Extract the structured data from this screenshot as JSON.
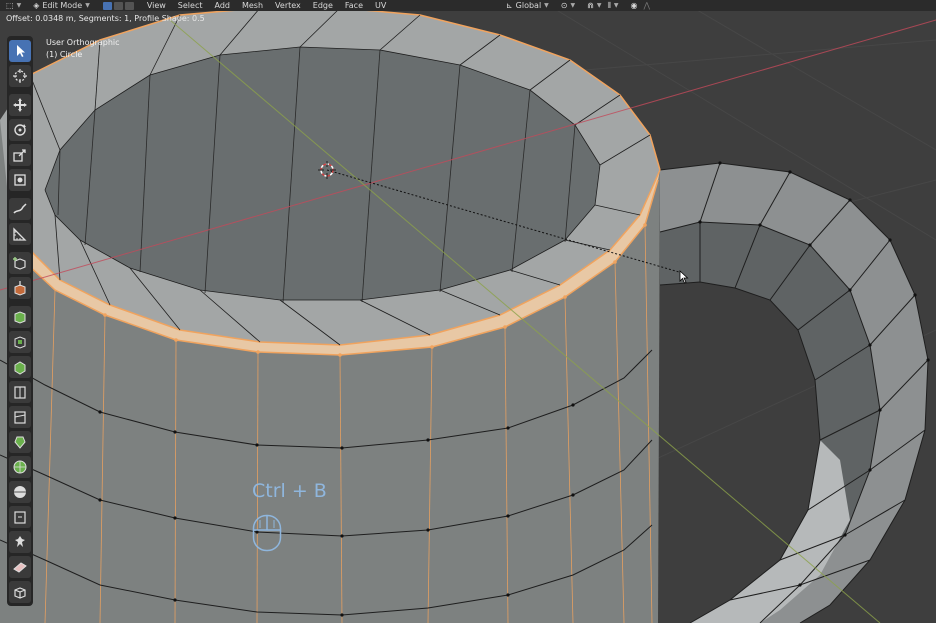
{
  "header": {
    "mode_label": "Edit Mode",
    "menus": [
      "View",
      "Select",
      "Add",
      "Mesh",
      "Vertex",
      "Edge",
      "Face",
      "UV"
    ],
    "transform_orientation": "Global"
  },
  "status_text": "Offset: 0.0348 m, Segments: 1, Profile Shape: 0.5",
  "viewport": {
    "view_name": "User Orthographic",
    "object_name": "(1) Circle"
  },
  "toolbar": {
    "tools": [
      "select-box",
      "cursor",
      "move",
      "rotate",
      "scale",
      "transform",
      "annotate",
      "measure",
      "add-cube",
      "extrude-region",
      "inset-faces",
      "bevel",
      "loop-cut",
      "knife",
      "poly-build",
      "spin",
      "smooth",
      "edge-slide",
      "shrink-fatten",
      "shear",
      "rip-region"
    ],
    "active_tool": "select-box"
  },
  "overlay": {
    "shortcut_text": "Ctrl + B"
  },
  "colors": {
    "accent": "#4772b3",
    "selection": "#f0a35e",
    "x_axis": "#c24a5a",
    "y_axis": "#8ca24a",
    "shortcut": "#8fb6dd"
  }
}
